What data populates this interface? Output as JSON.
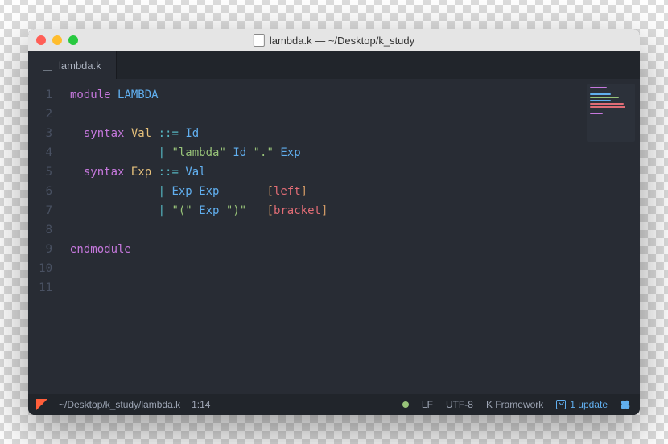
{
  "window": {
    "title": "lambda.k — ~/Desktop/k_study"
  },
  "tabs": [
    {
      "label": "lambda.k"
    }
  ],
  "editor": {
    "lines": [
      [
        {
          "t": "module",
          "c": "tok-keyword"
        },
        {
          "t": " "
        },
        {
          "t": "LAMBDA",
          "c": "tok-type"
        }
      ],
      [],
      [
        {
          "t": "  "
        },
        {
          "t": "syntax",
          "c": "tok-keyword"
        },
        {
          "t": " "
        },
        {
          "t": "Val",
          "c": "tok-ident"
        },
        {
          "t": " "
        },
        {
          "t": "::=",
          "c": "tok-op"
        },
        {
          "t": " "
        },
        {
          "t": "Id",
          "c": "tok-type"
        }
      ],
      [
        {
          "t": "             "
        },
        {
          "t": "|",
          "c": "tok-op"
        },
        {
          "t": " "
        },
        {
          "t": "\"lambda\"",
          "c": "tok-string"
        },
        {
          "t": " "
        },
        {
          "t": "Id",
          "c": "tok-type"
        },
        {
          "t": " "
        },
        {
          "t": "\".\"",
          "c": "tok-string"
        },
        {
          "t": " "
        },
        {
          "t": "Exp",
          "c": "tok-type"
        }
      ],
      [
        {
          "t": "  "
        },
        {
          "t": "syntax",
          "c": "tok-keyword"
        },
        {
          "t": " "
        },
        {
          "t": "Exp",
          "c": "tok-ident"
        },
        {
          "t": " "
        },
        {
          "t": "::=",
          "c": "tok-op"
        },
        {
          "t": " "
        },
        {
          "t": "Val",
          "c": "tok-type"
        }
      ],
      [
        {
          "t": "             "
        },
        {
          "t": "|",
          "c": "tok-op"
        },
        {
          "t": " "
        },
        {
          "t": "Exp",
          "c": "tok-type"
        },
        {
          "t": " "
        },
        {
          "t": "Exp",
          "c": "tok-type"
        },
        {
          "t": "       "
        },
        {
          "t": "[",
          "c": "tok-attr-br"
        },
        {
          "t": "left",
          "c": "tok-attr"
        },
        {
          "t": "]",
          "c": "tok-attr-br"
        }
      ],
      [
        {
          "t": "             "
        },
        {
          "t": "|",
          "c": "tok-op"
        },
        {
          "t": " "
        },
        {
          "t": "\"(\"",
          "c": "tok-string"
        },
        {
          "t": " "
        },
        {
          "t": "Exp",
          "c": "tok-type"
        },
        {
          "t": " "
        },
        {
          "t": "\")\"",
          "c": "tok-string"
        },
        {
          "t": "   "
        },
        {
          "t": "[",
          "c": "tok-attr-br"
        },
        {
          "t": "bracket",
          "c": "tok-attr"
        },
        {
          "t": "]",
          "c": "tok-attr-br"
        }
      ],
      [],
      [
        {
          "t": "endmodule",
          "c": "tok-keyword"
        }
      ],
      [],
      []
    ],
    "line_count": 11
  },
  "statusbar": {
    "path": "~/Desktop/k_study/lambda.k",
    "position": "1:14",
    "line_ending": "LF",
    "encoding": "UTF-8",
    "grammar": "K Framework",
    "update_label": "1 update"
  }
}
